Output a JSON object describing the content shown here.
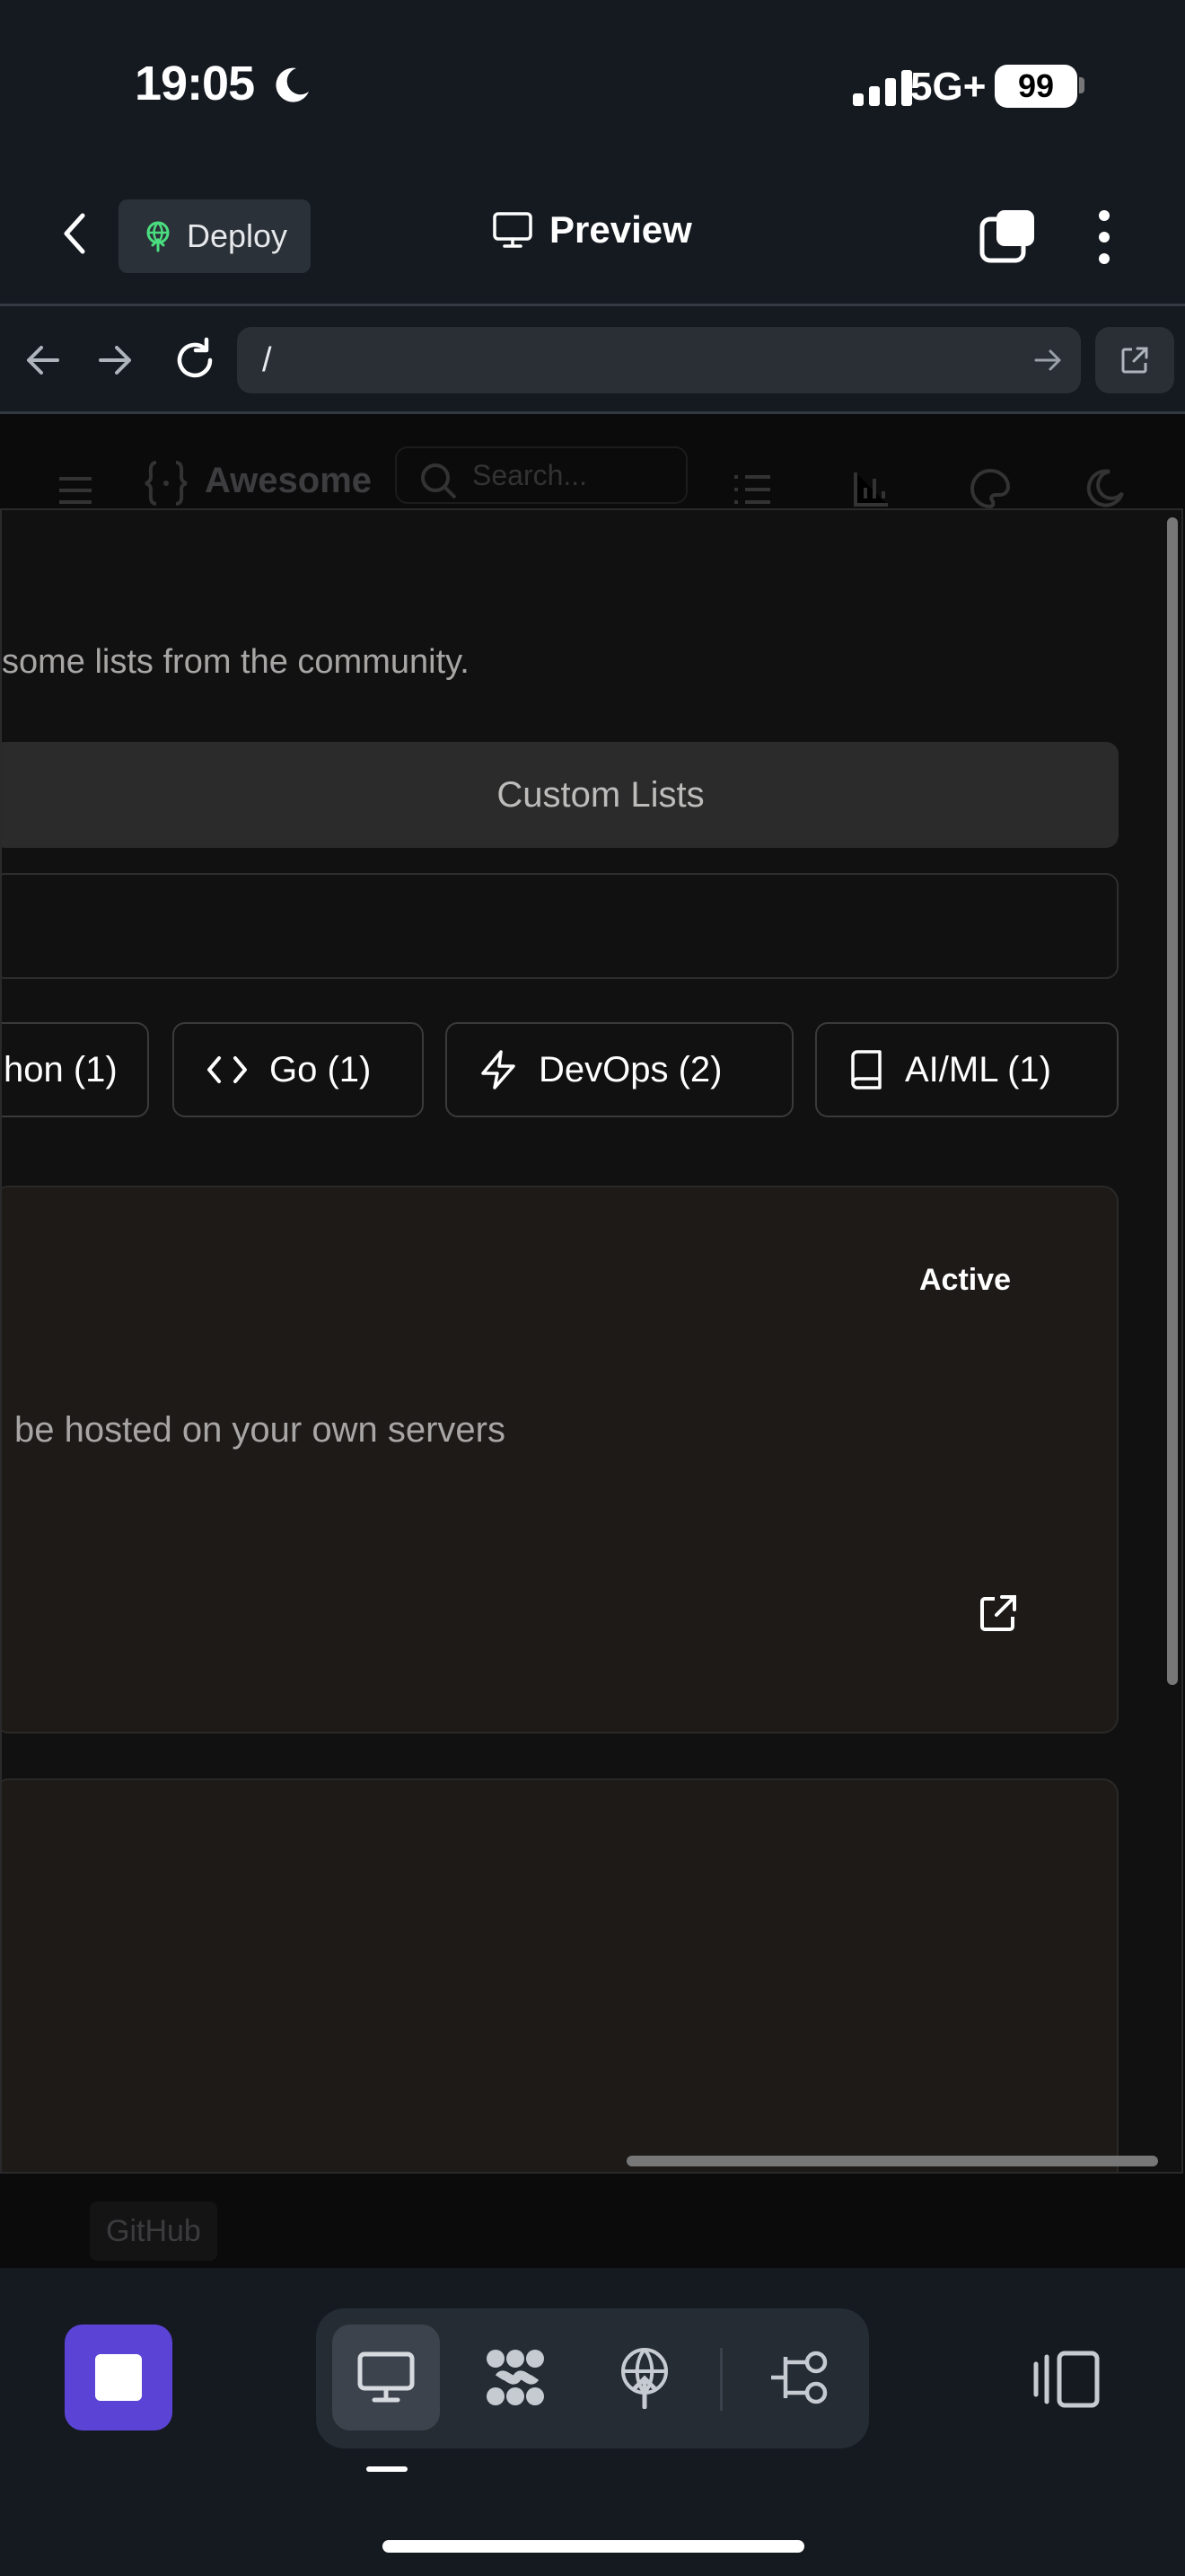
{
  "status_bar": {
    "time": "19:05",
    "network": "5G+",
    "battery": "99"
  },
  "header": {
    "deploy_label": "Deploy",
    "preview_label": "Preview"
  },
  "browser": {
    "url": "/"
  },
  "site": {
    "brand": "Awesome",
    "search_placeholder": "Search...",
    "footer_github": "GitHub"
  },
  "panel": {
    "intro_text": "some lists from the community.",
    "custom_tab_label": "Custom Lists",
    "categories": [
      {
        "label": "hon (1)",
        "icon": "python-icon"
      },
      {
        "label": "Go (1)",
        "icon": "code-icon"
      },
      {
        "label": "DevOps (2)",
        "icon": "lightning-icon"
      },
      {
        "label": "AI/ML (1)",
        "icon": "book-icon"
      }
    ],
    "card1": {
      "status": "Active",
      "description": "be hosted on your own servers"
    }
  },
  "colors": {
    "accent": "#5b43d6",
    "background": "#151a21",
    "panel": "#121111",
    "card": "#1d1a18"
  }
}
